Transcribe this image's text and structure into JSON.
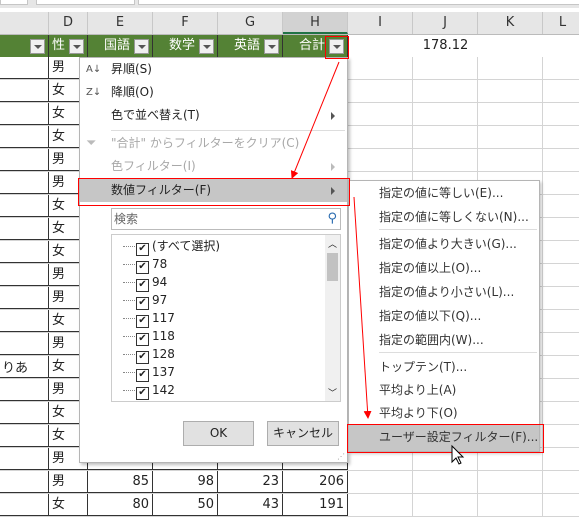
{
  "columns": [
    "D",
    "E",
    "F",
    "G",
    "H",
    "I",
    "J",
    "K",
    "L"
  ],
  "selected_column": "H",
  "header_row": {
    "c": "",
    "d": "性",
    "e": "国語",
    "f": "数学",
    "g": "英語",
    "h": "合計"
  },
  "j1_value": "178.12",
  "partial_text": "りあ",
  "gender_col": [
    "男",
    "女",
    "女",
    "女",
    "男",
    "男",
    "女",
    "女",
    "女",
    "男",
    "男",
    "女",
    "男",
    "女",
    "男",
    "女",
    "女",
    "男",
    "男",
    "女"
  ],
  "visible_scores": [
    {
      "e": "85",
      "f": "98",
      "g": "23",
      "h": "206"
    },
    {
      "e": "80",
      "f": "50",
      "g": "43",
      "h": "191"
    }
  ],
  "menu": {
    "sort_asc": "昇順(S)",
    "sort_desc": "降順(O)",
    "sort_color": "色で並べ替え(T)",
    "clear_filter": "\"合計\" からフィルターをクリア(C)",
    "color_filter": "色フィルター(I)",
    "number_filter": "数値フィルター(F)",
    "search_placeholder": "検索",
    "list_items": [
      "(すべて選択)",
      "78",
      "94",
      "97",
      "117",
      "118",
      "128",
      "137",
      "142"
    ],
    "ok": "OK",
    "cancel": "キャンセル"
  },
  "submenu": [
    "指定の値に等しい(E)...",
    "指定の値に等しくない(N)...",
    "指定の値より大きい(G)...",
    "指定の値以上(O)...",
    "指定の値より小さい(L)...",
    "指定の値以下(Q)...",
    "指定の範囲内(W)...",
    "トップテン(T)...",
    "平均より上(A)",
    "平均より下(O)",
    "ユーザー設定フィルター(F)..."
  ],
  "colors": {
    "header_green": "#548235",
    "annotation_red": "#ff0000",
    "highlight": "#c6c6c6"
  }
}
